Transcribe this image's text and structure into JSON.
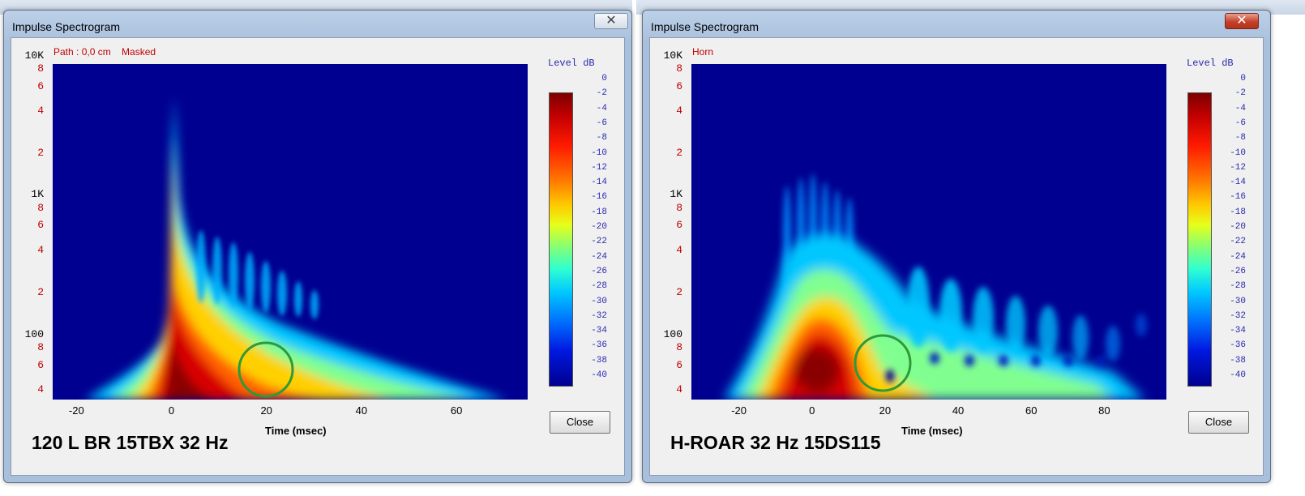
{
  "colors": {
    "plot_bg": "#000090",
    "circle": "#2e9a3a",
    "tick_red": "#c00000",
    "colorbar_text": "#2a2ab0"
  },
  "windows": [
    {
      "title": "Impulse Spectrogram",
      "path_label": "Path : 0,0 cm    Masked",
      "y_ticks": [
        "10K",
        "8",
        "6",
        "4",
        "2",
        "1K",
        "8",
        "6",
        "4",
        "2",
        "100",
        "8",
        "6",
        "4"
      ],
      "x_ticks": [
        "-20",
        "0",
        "20",
        "40",
        "60"
      ],
      "x_label": "Time (msec)",
      "colorbar_title": "Level   dB",
      "colorbar_ticks": [
        "0",
        "-2",
        "-4",
        "-6",
        "-8",
        "-10",
        "-12",
        "-14",
        "-16",
        "-18",
        "-20",
        "-22",
        "-24",
        "-26",
        "-28",
        "-30",
        "-32",
        "-34",
        "-36",
        "-38",
        "-40"
      ],
      "close_label": "Close",
      "caption": "120 L BR 15TBX 32 Hz"
    },
    {
      "title": "Impulse Spectrogram",
      "path_label": "Horn",
      "y_ticks": [
        "10K",
        "8",
        "6",
        "4",
        "2",
        "1K",
        "8",
        "6",
        "4",
        "2",
        "100",
        "8",
        "6",
        "4"
      ],
      "x_ticks": [
        "-20",
        "0",
        "20",
        "40",
        "60",
        "80"
      ],
      "x_label": "Time (msec)",
      "colorbar_title": "Level   dB",
      "colorbar_ticks": [
        "0",
        "-2",
        "-4",
        "-6",
        "-8",
        "-10",
        "-12",
        "-14",
        "-16",
        "-18",
        "-20",
        "-22",
        "-24",
        "-26",
        "-28",
        "-30",
        "-32",
        "-34",
        "-36",
        "-38",
        "-40"
      ],
      "close_label": "Close",
      "caption": "H-ROAR 32 Hz 15DS115"
    }
  ]
}
